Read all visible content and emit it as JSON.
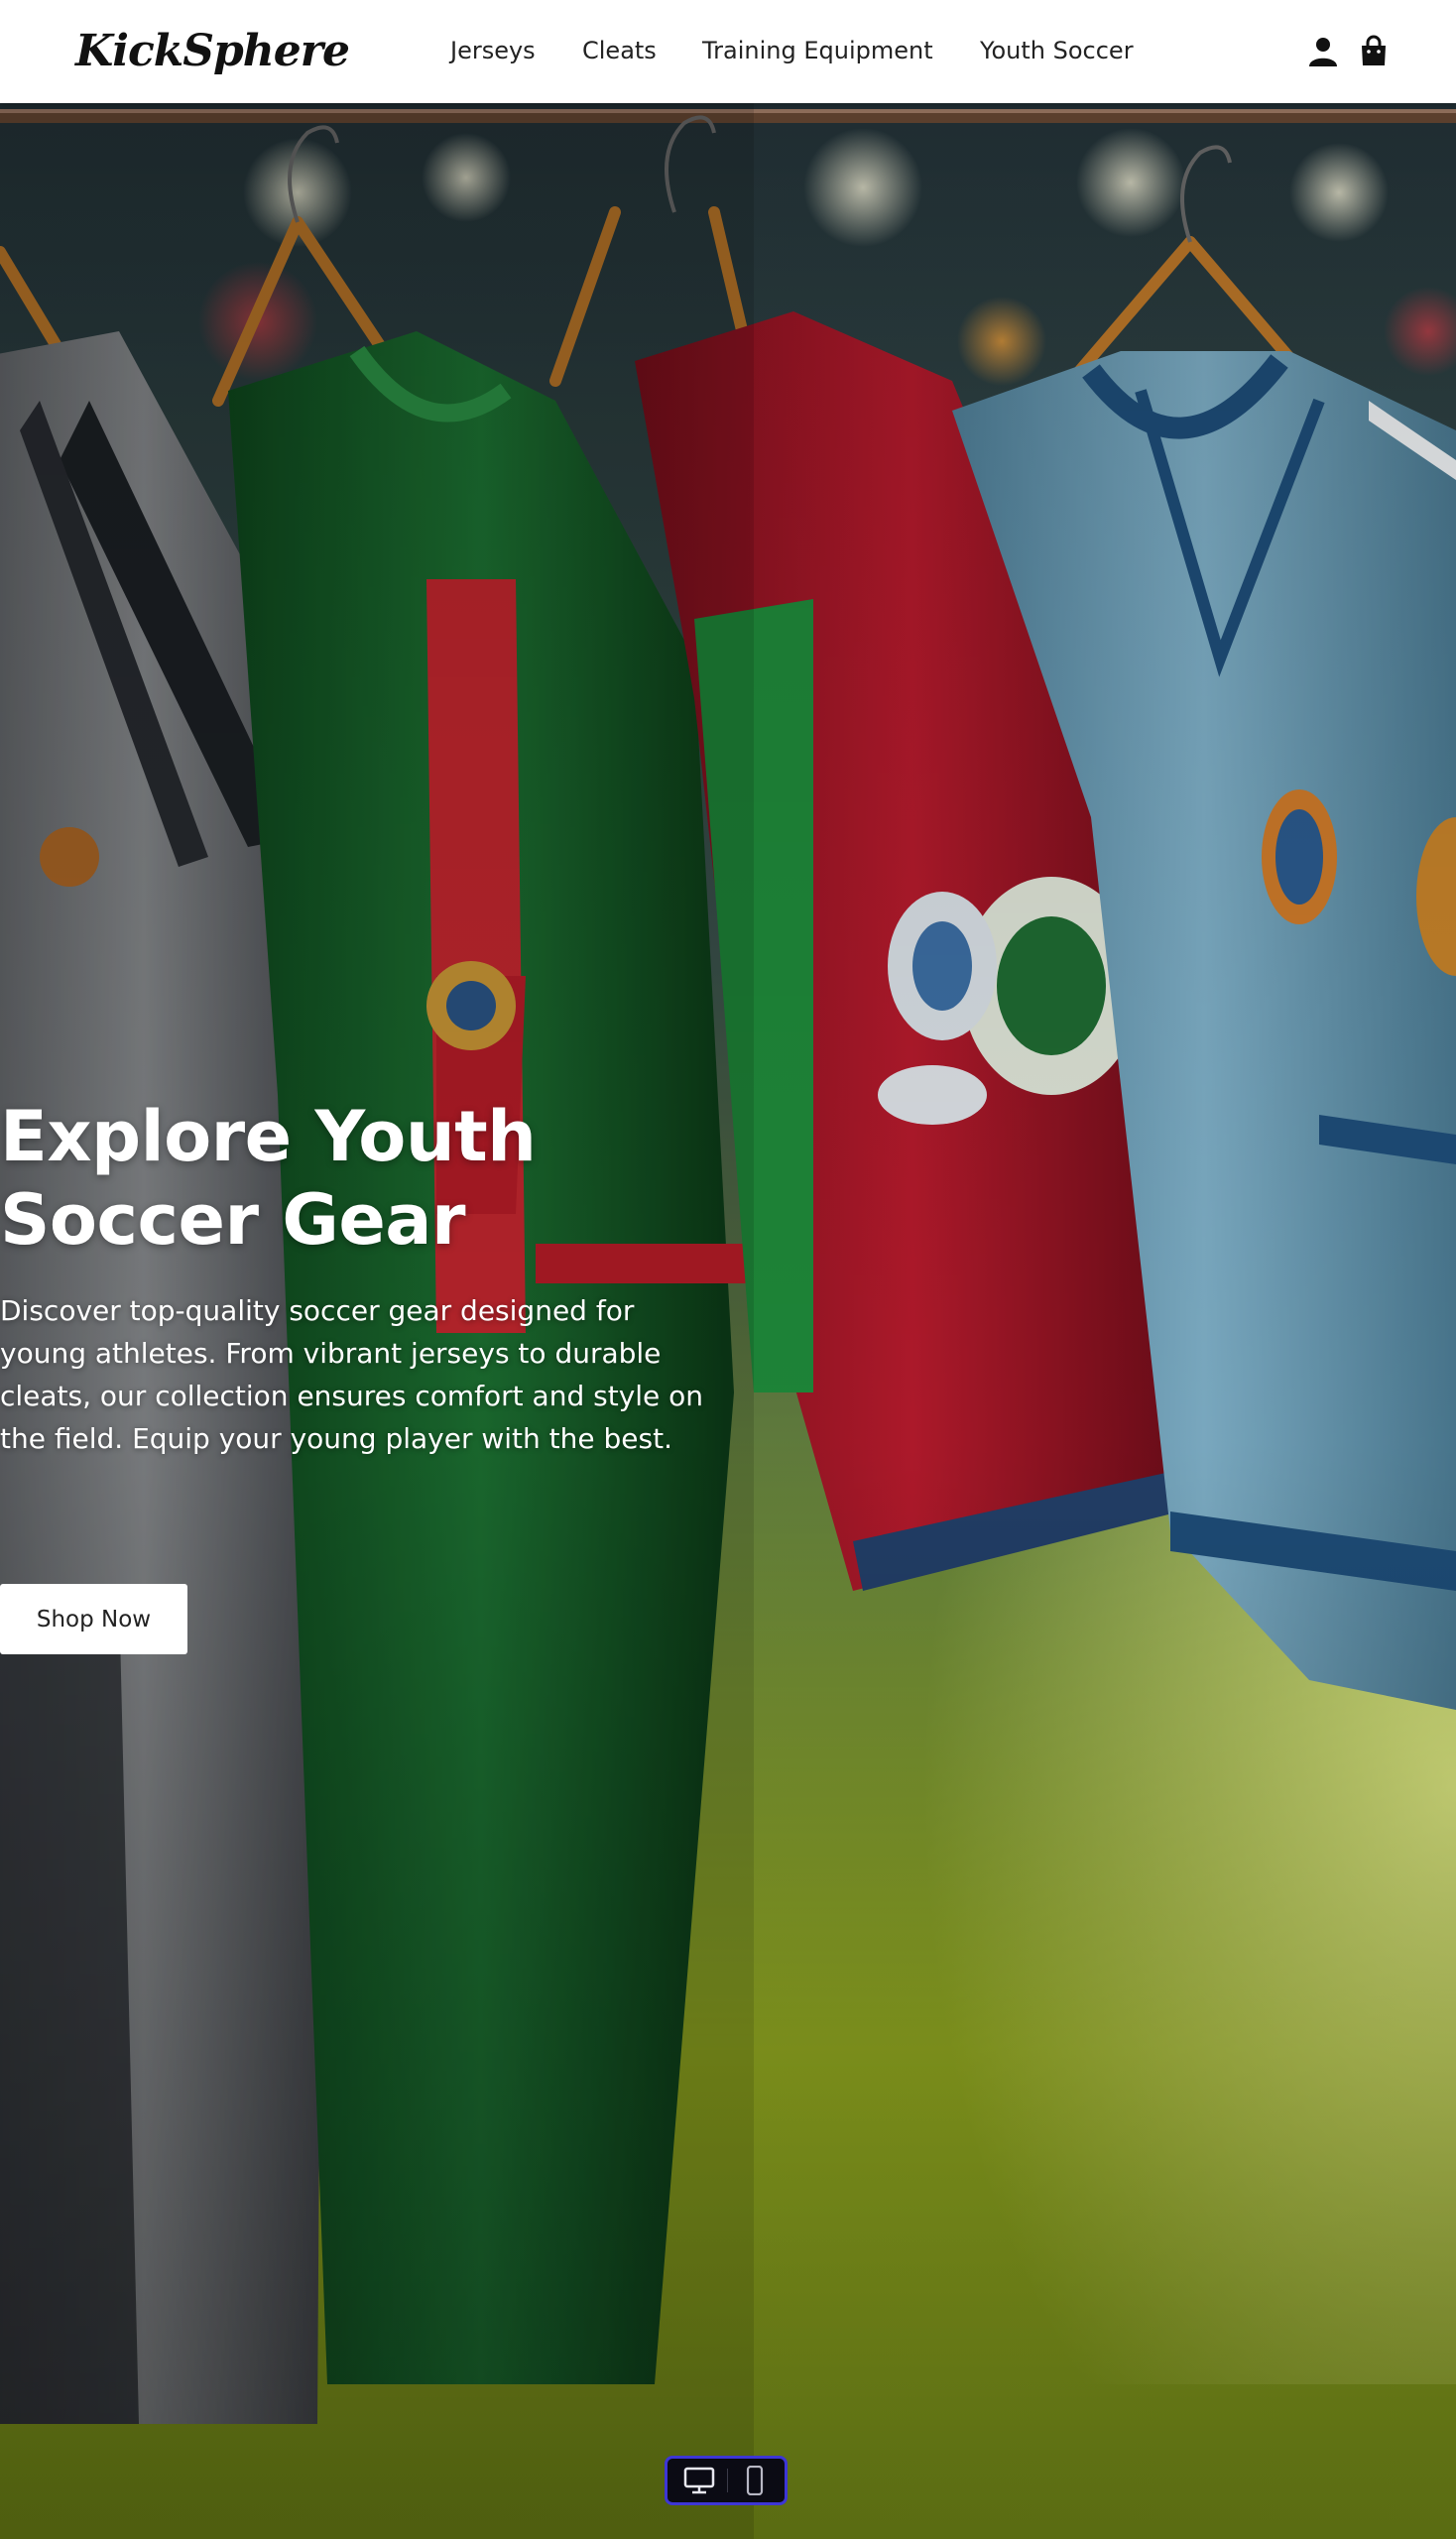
{
  "header": {
    "logo": "KickSphere",
    "nav": [
      "Jerseys",
      "Cleats",
      "Training Equipment",
      "Youth Soccer"
    ],
    "icons": [
      "account-icon",
      "shopping-bag-icon"
    ]
  },
  "hero": {
    "title": "Explore Youth Soccer Gear",
    "description": "Discover top-quality soccer gear designed for young athletes. From vibrant jerseys to durable cleats, our collection ensures comfort and style on the field. Equip your young player with the best.",
    "cta_label": "Shop Now",
    "background": "jerseys-on-hangers-photo"
  },
  "device_toggle": {
    "options": [
      "desktop-icon",
      "mobile-icon"
    ],
    "accent": "#3d36d6"
  }
}
